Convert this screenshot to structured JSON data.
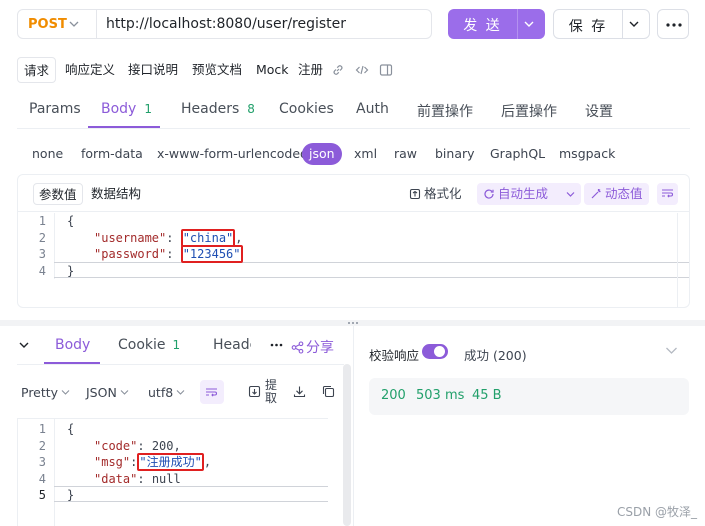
{
  "request": {
    "method": "POST",
    "url": "http://localhost:8080/user/register",
    "send_label": "发 送",
    "save_label": "保 存"
  },
  "sub_tabs": [
    {
      "label": "请求",
      "active": true
    },
    {
      "label": "响应定义"
    },
    {
      "label": "接口说明"
    },
    {
      "label": "预览文档"
    },
    {
      "label": "Mock"
    },
    {
      "label": "注册"
    }
  ],
  "request_tabs": [
    {
      "label": "Params"
    },
    {
      "label": "Body",
      "count": "1",
      "active": true
    },
    {
      "label": "Headers",
      "count": "8"
    },
    {
      "label": "Cookies"
    },
    {
      "label": "Auth"
    },
    {
      "label": "前置操作"
    },
    {
      "label": "后置操作"
    },
    {
      "label": "设置"
    }
  ],
  "body_types": [
    "none",
    "form-data",
    "x-www-form-urlencoded",
    "json",
    "xml",
    "raw",
    "binary",
    "GraphQL",
    "msgpack"
  ],
  "body_type_active": "json",
  "editor_tabs": [
    "参数值",
    "数据结构"
  ],
  "editor_tools": {
    "format": "格式化",
    "auto_generate": "自动生成",
    "dynamic_value": "动态值"
  },
  "request_body": {
    "line_numbers": [
      "1",
      "2",
      "3",
      "4"
    ],
    "open": "{",
    "close": "}",
    "fields": [
      {
        "key": "\"username\"",
        "value": "\"china\"",
        "trail": ","
      },
      {
        "key": "\"password\"",
        "value": "\"123456\"",
        "trail": ""
      }
    ]
  },
  "response": {
    "tabs": [
      "Body",
      "Cookie",
      "Heade"
    ],
    "cookie_count": "1",
    "share_label": "分享",
    "format_options": {
      "pretty": "Pretty",
      "type": "JSON",
      "encoding": "utf8"
    },
    "extract_label": "提取",
    "line_numbers": [
      "1",
      "2",
      "3",
      "4",
      "5"
    ],
    "open": "{",
    "close": "}",
    "fields": [
      {
        "key": "\"code\"",
        "value": "200",
        "trail": ","
      },
      {
        "key": "\"msg\"",
        "value": "\"注册成功\"",
        "trail": ","
      },
      {
        "key": "\"data\"",
        "value": "null",
        "trail": ""
      }
    ],
    "validate_label": "校验响应",
    "validate_on": true,
    "validate_status": "成功 (200)",
    "status_code": "200",
    "time": "503 ms",
    "size": "45 B"
  },
  "watermark": "CSDN @牧泽_",
  "colors": {
    "accent": "#8c5bd9",
    "send": "#9b6dea",
    "method": "#f08c00",
    "success": "#22a06b",
    "highlight": "#e02020"
  }
}
